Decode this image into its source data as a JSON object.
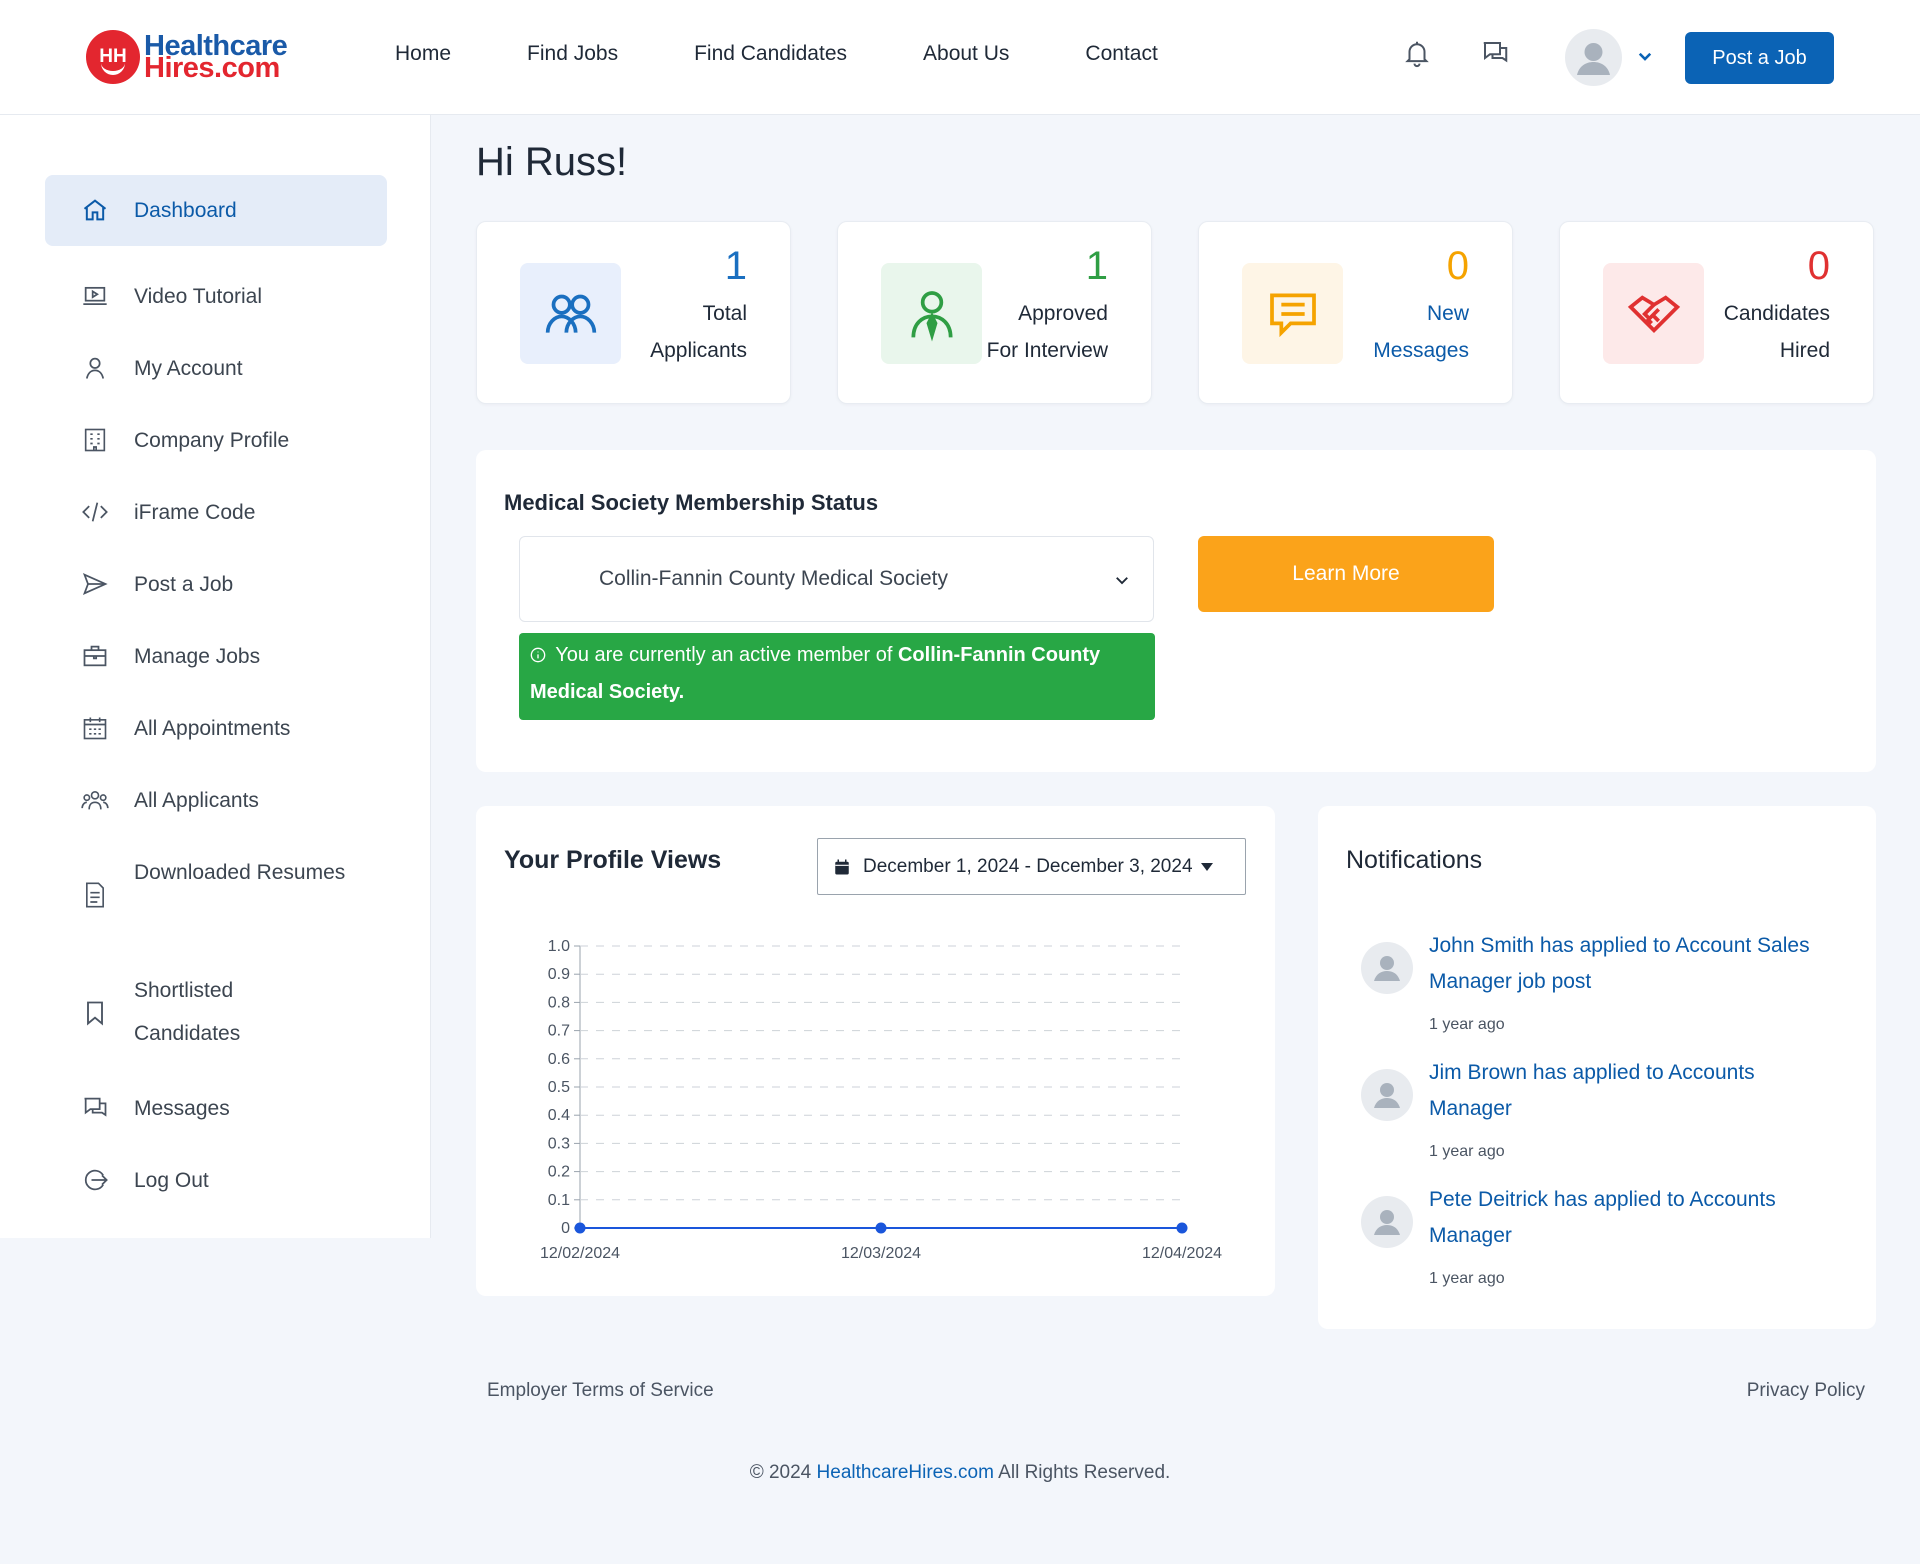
{
  "brand": {
    "line1": "Healthcare",
    "line2": "Hires.com",
    "badge": "HH"
  },
  "nav": [
    "Home",
    "Find Jobs",
    "Find Candidates",
    "About Us",
    "Contact"
  ],
  "header": {
    "post_job": "Post a Job"
  },
  "sidebar": [
    {
      "label": "Dashboard",
      "icon": "home-icon",
      "active": true
    },
    {
      "label": "Video Tutorial",
      "icon": "video-icon"
    },
    {
      "label": "My Account",
      "icon": "user-icon"
    },
    {
      "label": "Company Profile",
      "icon": "building-icon"
    },
    {
      "label": "iFrame Code",
      "icon": "code-icon"
    },
    {
      "label": "Post a Job",
      "icon": "send-icon"
    },
    {
      "label": "Manage Jobs",
      "icon": "briefcase-icon"
    },
    {
      "label": "All Appointments",
      "icon": "calendar-icon"
    },
    {
      "label": "All Applicants",
      "icon": "group-icon"
    },
    {
      "label": "Downloaded Resumes",
      "icon": "document-icon"
    },
    {
      "label": "Shortlisted Candidates",
      "icon": "bookmark-icon"
    },
    {
      "label": "Messages",
      "icon": "chat-icon"
    },
    {
      "label": "Log Out",
      "icon": "logout-icon"
    }
  ],
  "greeting": "Hi Russ!",
  "stats": [
    {
      "value": "1",
      "line1": "Total",
      "line2": "Applicants",
      "color": "#1a6fc0",
      "bg": "#e8effc",
      "icon": "users-icon"
    },
    {
      "value": "1",
      "line1": "Approved",
      "line2": "For Interview",
      "color": "#2f9e44",
      "bg": "#e9f6ec",
      "icon": "interview-icon"
    },
    {
      "value": "0",
      "line1": "New",
      "line2": "Messages",
      "color": "#f5a300",
      "bg": "#fef5e6",
      "icon": "message-icon"
    },
    {
      "value": "0",
      "line1": "Candidates",
      "line2": "Hired",
      "color": "#e03131",
      "bg": "#fde9e9",
      "icon": "handshake-icon"
    }
  ],
  "membership": {
    "title": "Medical Society Membership Status",
    "selected": "Collin-Fannin County Medical Society",
    "learn_more": "Learn More",
    "alert_prefix": "You are currently an active member of",
    "alert_org": "Collin-Fannin County Medical Society."
  },
  "views": {
    "title": "Your Profile Views",
    "date_range": "December 1, 2024 - December 3, 2024"
  },
  "chart_data": {
    "type": "line",
    "x": [
      "12/02/2024",
      "12/03/2024",
      "12/04/2024"
    ],
    "series": [
      {
        "values": [
          0,
          0,
          0
        ]
      }
    ],
    "ylim": [
      0,
      1.0
    ],
    "yticks": [
      "0",
      "0.1",
      "0.2",
      "0.3",
      "0.4",
      "0.5",
      "0.6",
      "0.7",
      "0.8",
      "0.9",
      "1.0"
    ],
    "grid": true,
    "color": "#1a56db"
  },
  "notifications": {
    "title": "Notifications",
    "items": [
      {
        "text": "John Smith has applied to Account Sales Manager job post",
        "time": "1 year ago"
      },
      {
        "text": "Jim Brown has applied to Accounts Manager",
        "time": "1 year ago"
      },
      {
        "text": "Pete Deitrick has applied to Accounts Manager",
        "time": "1 year ago"
      }
    ]
  },
  "footer": {
    "terms": "Employer Terms of Service",
    "privacy": "Privacy Policy",
    "copyright_prefix": "© 2024",
    "copyright_link": "HealthcareHires.com",
    "copyright_suffix": "All Rights Reserved."
  }
}
